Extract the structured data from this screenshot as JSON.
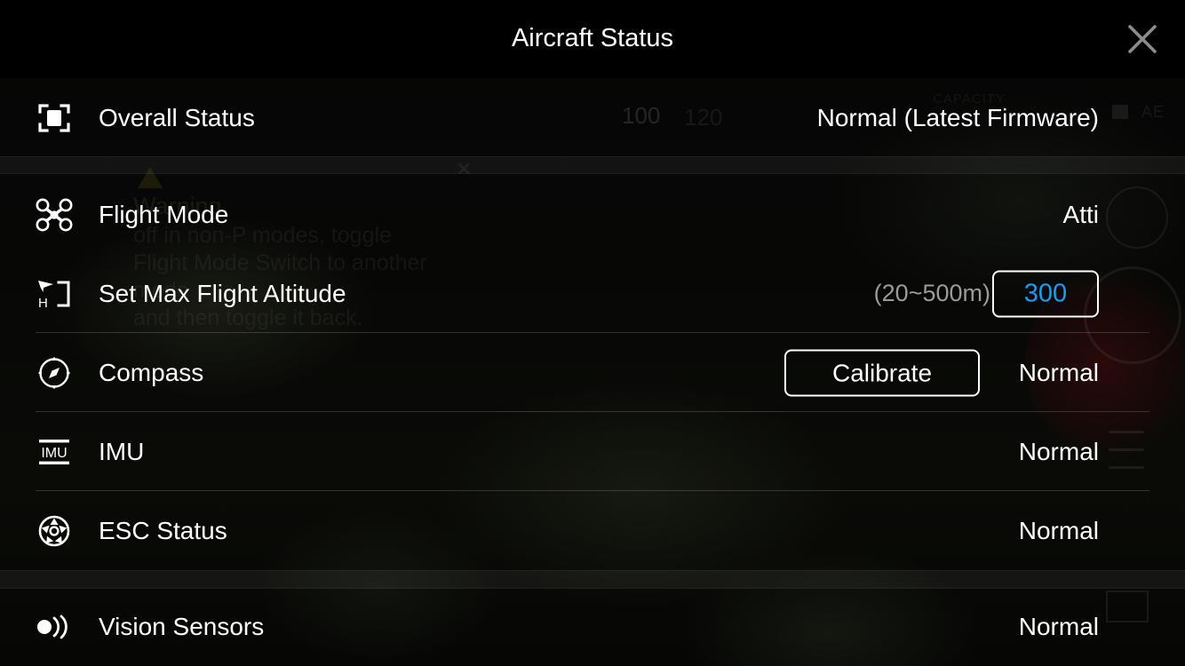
{
  "header": {
    "title": "Aircraft Status",
    "close_icon": "close-icon"
  },
  "colors": {
    "accent_blue": "#1e9bf0",
    "text_primary": "#ffffff",
    "text_muted": "#9b9b9b",
    "background": "#000000",
    "separator": "rgba(255,255,255,0.17)"
  },
  "rows": [
    {
      "id": "overall-status",
      "icon": "aircraft-frame-icon",
      "label": "Overall Status",
      "value": "Normal (Latest Firmware)"
    },
    {
      "id": "flight-mode",
      "icon": "quadcopter-drone-icon",
      "label": "Flight Mode",
      "value": "Atti"
    },
    {
      "id": "max-flight-altitude",
      "icon": "altitude-height-icon",
      "label": "Set Max Flight Altitude",
      "hint": "(20~500m)",
      "input_value": "300",
      "input_placeholder": "300"
    },
    {
      "id": "compass",
      "icon": "compass-icon",
      "label": "Compass",
      "button": "Calibrate",
      "value": "Normal"
    },
    {
      "id": "imu",
      "icon": "imu-icon",
      "label": "IMU",
      "value": "Normal"
    },
    {
      "id": "esc-status",
      "icon": "esc-gear-icon",
      "label": "ESC Status",
      "value": "Normal"
    },
    {
      "id": "vision-sensors",
      "icon": "vision-sensor-wave-icon",
      "label": "Vision Sensors",
      "value": "Normal"
    }
  ],
  "background": {
    "warning_title": "Warning",
    "warning_body": "off in non-P modes, toggle\nFlight Mode Switch to another mode\nand then toggle it back.",
    "camera_ae": "AE",
    "camera_capacity": "CAPACITY",
    "telemetry_100": "100",
    "telemetry_120": "120"
  }
}
